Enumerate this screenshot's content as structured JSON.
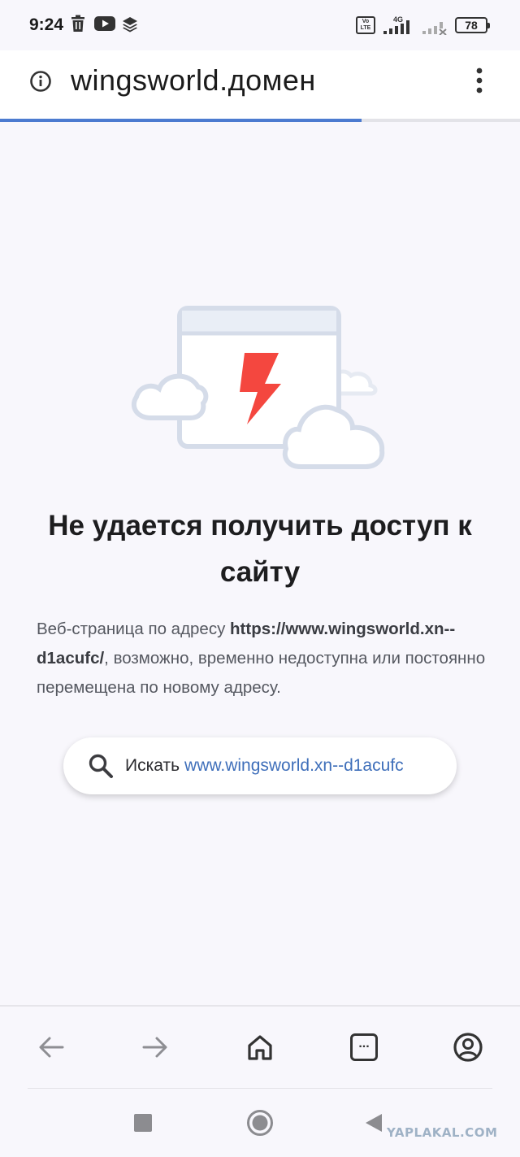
{
  "status_bar": {
    "time": "9:24",
    "network": "4G",
    "volte_label": "Vo LTE",
    "battery": "78"
  },
  "url_bar": {
    "url": "wingsworld.домен",
    "load_progress": 0.695
  },
  "error_page": {
    "title": "Не удается получить доступ к сайту",
    "description_prefix": "Веб-страница по адресу ",
    "description_url": "https://www.wingsworld.xn--d1acufc/",
    "description_suffix": ", возможно, временно недоступна или постоянно перемещена по новому адресу.",
    "search_label": "Искать",
    "search_query": "www.wingsworld.xn--d1acufc"
  },
  "bottom_toolbar": {
    "tabs_label": "..."
  },
  "watermark": "YAPLAKAL.COM",
  "colors": {
    "accent_blue": "#4c7bd0",
    "link_blue": "#3f6fba",
    "bolt_red": "#f4473f",
    "page_bg": "#f8f7fc"
  }
}
